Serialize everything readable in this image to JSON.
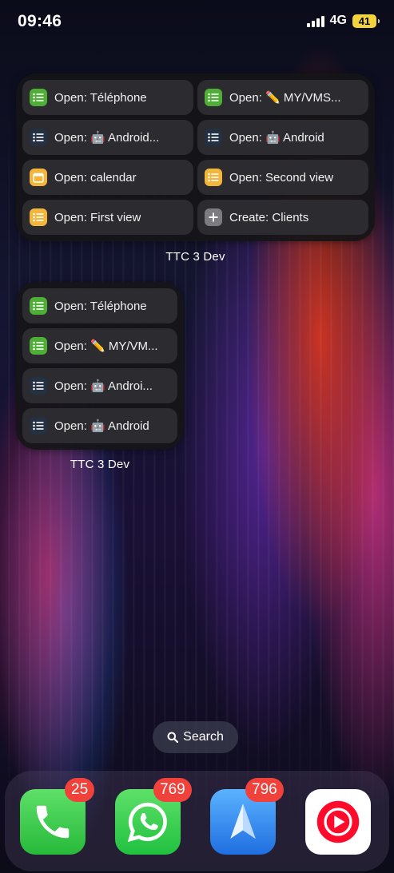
{
  "status_bar": {
    "time": "09:46",
    "network": "4G",
    "battery": "41"
  },
  "widget_large": {
    "title": "TTC 3 Dev",
    "shortcuts": [
      {
        "label": "Open: Téléphone",
        "icon": "list-icon",
        "color": "#4fae36"
      },
      {
        "label": "Open: ✏️ MY/VMS...",
        "icon": "list-icon",
        "color": "#4fae36"
      },
      {
        "label": "Open: 🤖  Android...",
        "icon": "list-icon",
        "color": "#233142"
      },
      {
        "label": "Open: 🤖  Android",
        "icon": "list-icon",
        "color": "#233142"
      },
      {
        "label": "Open: calendar",
        "icon": "calendar-icon",
        "color": "#f4b63a"
      },
      {
        "label": "Open: Second view",
        "icon": "list-icon",
        "color": "#f4b63a"
      },
      {
        "label": "Open: First view",
        "icon": "list-icon",
        "color": "#f4b63a"
      },
      {
        "label": "Create: Clients",
        "icon": "plus-icon",
        "color": "#7c7c80"
      }
    ]
  },
  "widget_small": {
    "title": "TTC 3 Dev",
    "shortcuts": [
      {
        "label": "Open: Téléphone",
        "icon": "list-icon",
        "color": "#4fae36"
      },
      {
        "label": "Open: ✏️ MY/VM...",
        "icon": "list-icon",
        "color": "#4fae36"
      },
      {
        "label": "Open: 🤖  Androi...",
        "icon": "list-icon",
        "color": "#233142"
      },
      {
        "label": "Open: 🤖  Android",
        "icon": "list-icon",
        "color": "#233142"
      }
    ]
  },
  "search": {
    "label": "Search",
    "icon": "magnifier-icon"
  },
  "dock": [
    {
      "app": "Phone",
      "icon": "phone-icon",
      "badge": "25",
      "color": "#3ec94b"
    },
    {
      "app": "WhatsApp",
      "icon": "whatsapp-icon",
      "badge": "769",
      "color": "#2fd14f"
    },
    {
      "app": "Spark",
      "icon": "paper-plane-icon",
      "badge": "796",
      "color": "#2f86f0"
    },
    {
      "app": "YouTube Music",
      "icon": "youtube-music-icon",
      "badge": "",
      "color": "#ffffff"
    }
  ]
}
